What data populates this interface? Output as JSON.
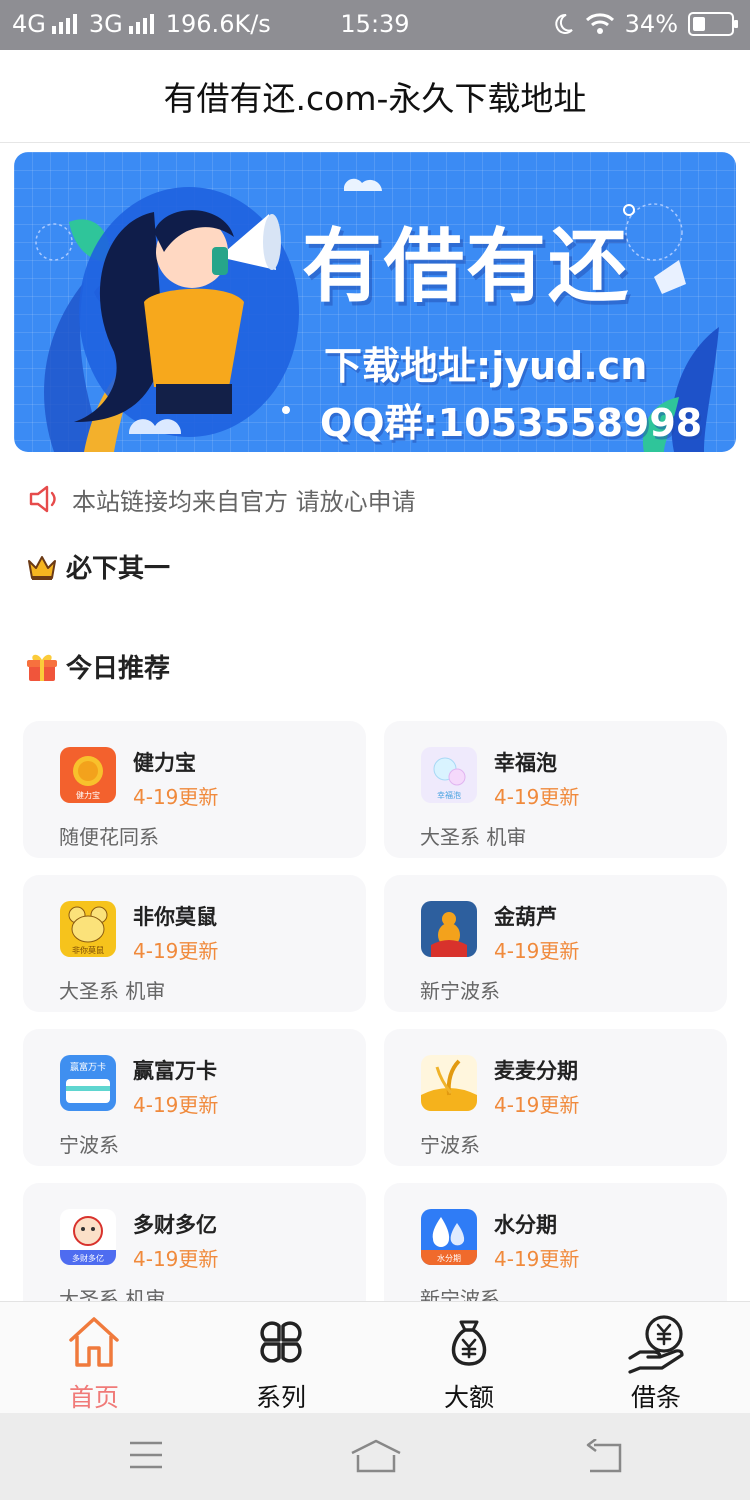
{
  "status_bar": {
    "network1": "4G",
    "network2": "3G",
    "speed": "196.6K/s",
    "time": "15:39",
    "battery_text": "34%",
    "battery_level": 0.34
  },
  "header": {
    "title": "有借有还.com-永久下载地址"
  },
  "banner": {
    "title": "有借有还",
    "download_line": "下载地址:jyud.cn",
    "qq_line": "QQ群:1053558998"
  },
  "notice": {
    "icon": "speaker-icon",
    "text": "本站链接均来自官方 请放心申请"
  },
  "sections": {
    "must_download": {
      "icon": "crown-icon",
      "label": "必下其一"
    },
    "today": {
      "icon": "gift-icon",
      "label": "今日推荐"
    }
  },
  "apps": [
    {
      "name": "健力宝",
      "update": "4-19更新",
      "system": "随便花同系",
      "icon": "jianlibao-app-icon",
      "icon_text": "健力宝",
      "color": "#f3612d"
    },
    {
      "name": "幸福泡",
      "update": "4-19更新",
      "system": "大圣系 机审",
      "icon": "xingfupao-app-icon",
      "icon_text": "幸福泡",
      "color": "#e7e4fb"
    },
    {
      "name": "非你莫鼠",
      "update": "4-19更新",
      "system": "大圣系 机审",
      "icon": "feinimoshu-app-icon",
      "icon_text": "非你莫鼠",
      "color": "#f6c31c"
    },
    {
      "name": "金葫芦",
      "update": "4-19更新",
      "system": "新宁波系",
      "icon": "jinhulu-app-icon",
      "icon_text": "",
      "color": "#2d5f9e"
    },
    {
      "name": "赢富万卡",
      "update": "4-19更新",
      "system": "宁波系",
      "icon": "yingfuwanka-app-icon",
      "icon_text": "赢富万卡",
      "color": "#3f8ff0"
    },
    {
      "name": "麦麦分期",
      "update": "4-19更新",
      "system": "宁波系",
      "icon": "maimaifenqi-app-icon",
      "icon_text": "",
      "color": "#f5b21c"
    },
    {
      "name": "多财多亿",
      "update": "4-19更新",
      "system": "大圣系 机审",
      "icon": "duocaiduoyi-app-icon",
      "icon_text": "多财多亿",
      "color": "#4e6cf0"
    },
    {
      "name": "水分期",
      "update": "4-19更新",
      "system": "新宁波系",
      "icon": "shuifenqi-app-icon",
      "icon_text": "水分期",
      "color": "#2f7cf6"
    }
  ],
  "tabbar": {
    "active_color": "#f07a78",
    "accent": "#f08a3c",
    "items": [
      {
        "label": "首页",
        "icon": "home-icon"
      },
      {
        "label": "系列",
        "icon": "grid-icon"
      },
      {
        "label": "大额",
        "icon": "money-bag-icon"
      },
      {
        "label": "借条",
        "icon": "hand-coin-icon"
      }
    ]
  },
  "system_nav": {
    "icons": [
      "menu-icon",
      "home-nav-icon",
      "back-icon"
    ]
  }
}
